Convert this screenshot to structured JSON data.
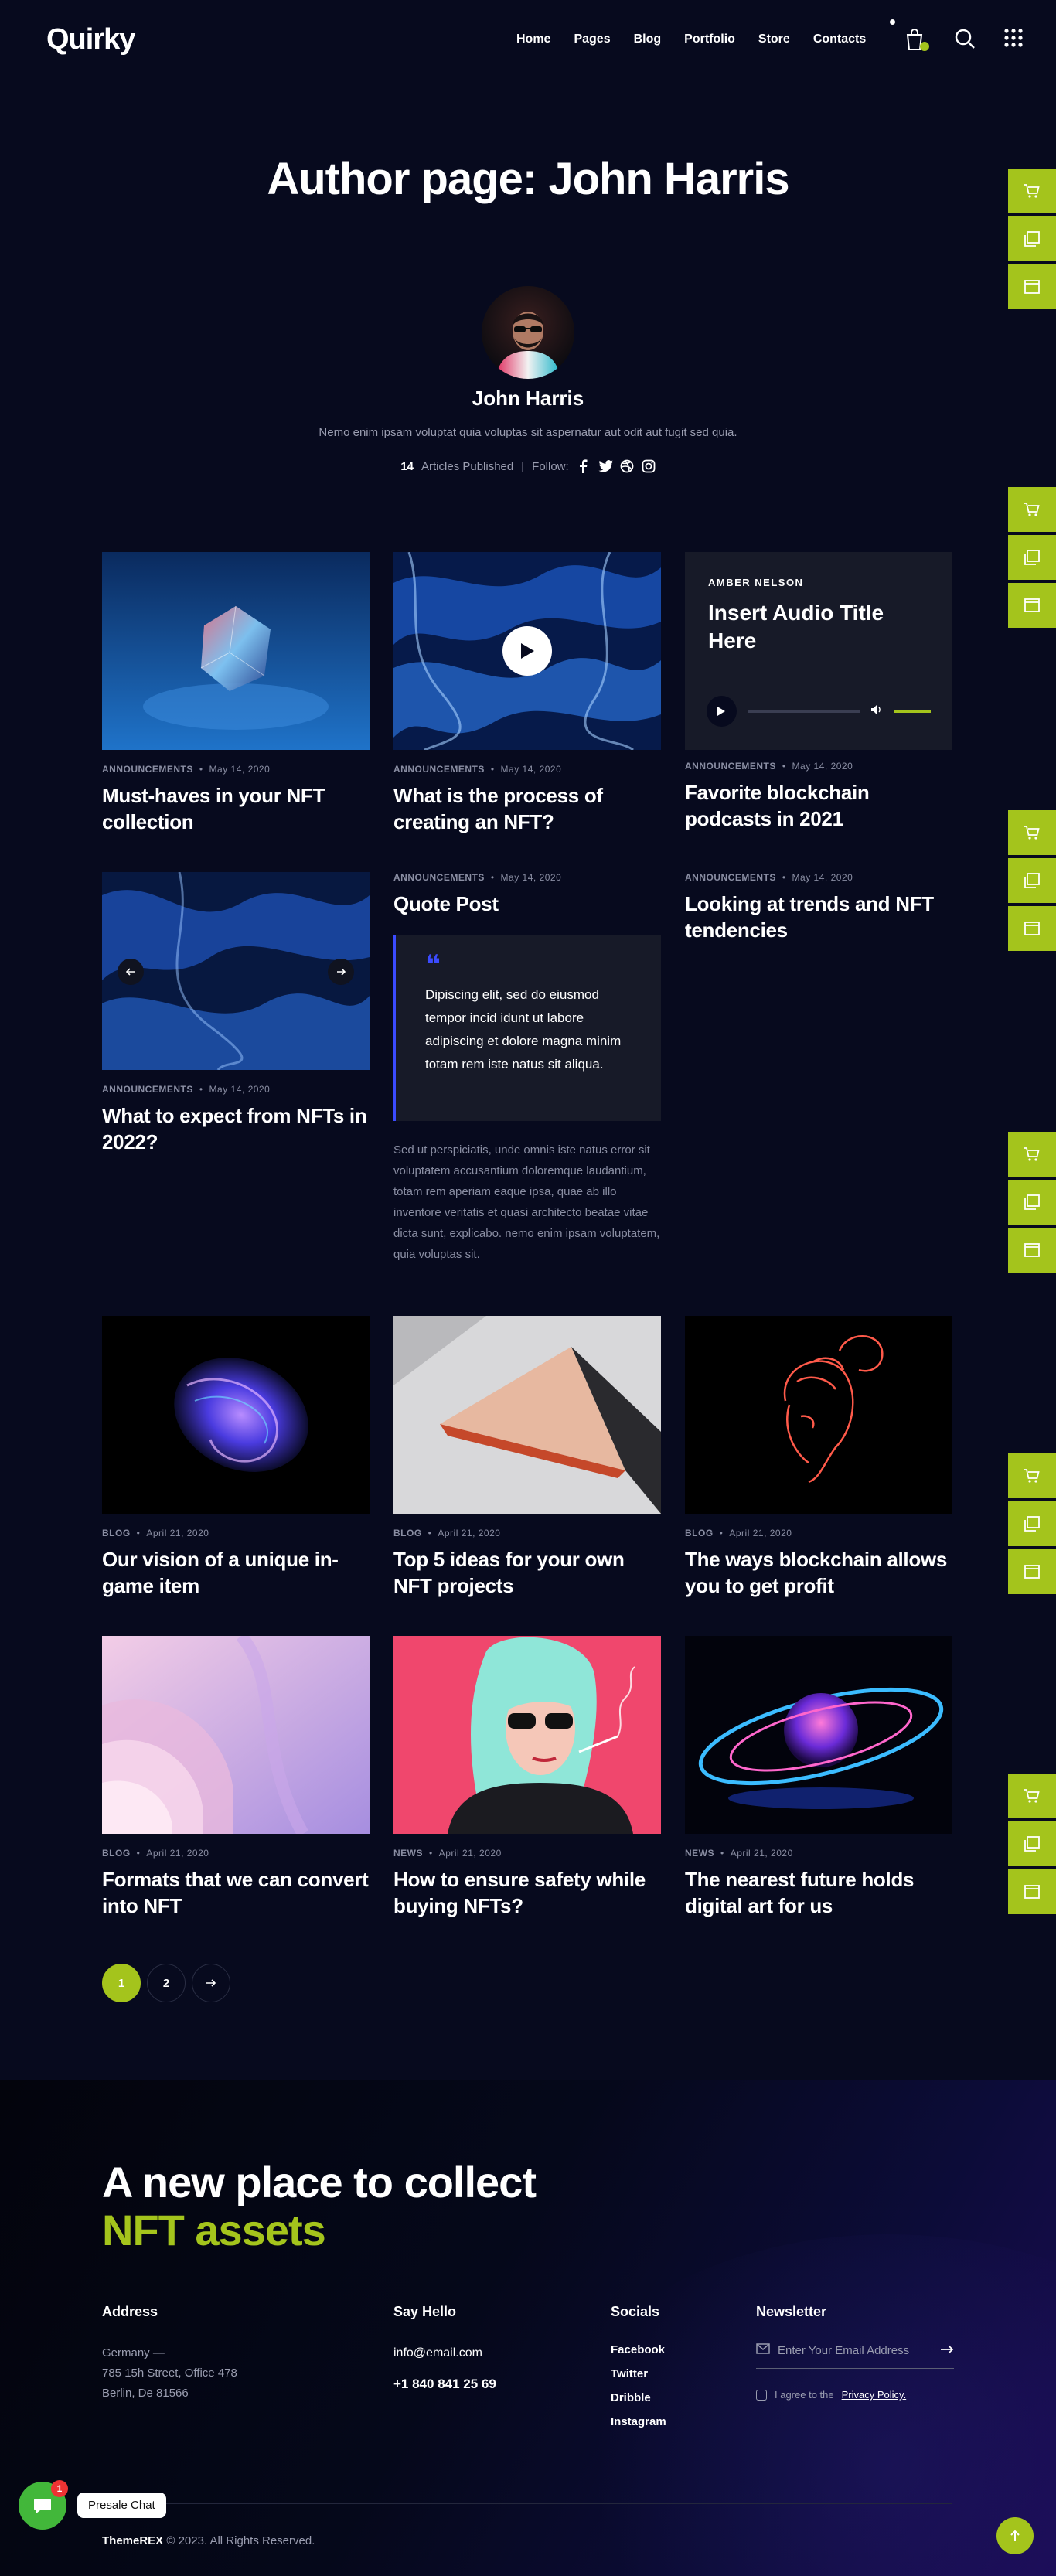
{
  "header": {
    "logo": "Quirky",
    "nav": [
      "Home",
      "Pages",
      "Blog",
      "Portfolio",
      "Store",
      "Contacts"
    ]
  },
  "page_title": "Author page: John Harris",
  "author": {
    "name": "John Harris",
    "bio": "Nemo enim ipsam voluptat quia voluptas sit aspernatur aut odit aut fugit sed quia.",
    "articles_count": "14",
    "articles_label": "Articles Published",
    "follow_label": "Follow:"
  },
  "posts": {
    "p1": {
      "category": "ANNOUNCEMENTS",
      "date": "May 14, 2020",
      "title": "Must-haves in your NFT collection"
    },
    "p2": {
      "category": "ANNOUNCEMENTS",
      "date": "May 14, 2020",
      "title": "What is the process of creating an NFT?"
    },
    "p3": {
      "category": "ANNOUNCEMENTS",
      "date": "May 14, 2020",
      "title": "Favorite blockchain podcasts in 2021",
      "audio_author": "AMBER NELSON",
      "audio_title": "Insert Audio Title Here"
    },
    "p4": {
      "category": "ANNOUNCEMENTS",
      "date": "May 14, 2020",
      "title": "What to expect from NFTs in 2022?"
    },
    "p5": {
      "category": "ANNOUNCEMENTS",
      "date": "May 14, 2020",
      "title": "Quote Post",
      "quote": "Dipiscing elit, sed do eiusmod tempor incid idunt ut labore adipiscing et dolore magna minim totam rem iste natus sit aliqua.",
      "body": "Sed ut perspiciatis, unde omnis iste natus error sit voluptatem accusantium doloremque laudantium, totam rem aperiam eaque ipsa, quae ab illo inventore veritatis et quasi architecto beatae vitae dicta sunt, explicabo. nemo enim ipsam voluptatem, quia voluptas sit."
    },
    "p6": {
      "category": "ANNOUNCEMENTS",
      "date": "May 14, 2020",
      "title": "Looking at trends and NFT tendencies"
    },
    "p7": {
      "category": "BLOG",
      "date": "April 21, 2020",
      "title": "Our vision of a unique in-game item"
    },
    "p8": {
      "category": "BLOG",
      "date": "April 21, 2020",
      "title": "Top 5 ideas for your own NFT projects"
    },
    "p9": {
      "category": "BLOG",
      "date": "April 21, 2020",
      "title": "The ways blockchain allows you to get profit"
    },
    "p10": {
      "category": "BLOG",
      "date": "April 21, 2020",
      "title": "Formats that we can convert into NFT"
    },
    "p11": {
      "category": "NEWS",
      "date": "April 21, 2020",
      "title": "How to ensure safety while buying NFTs?"
    },
    "p12": {
      "category": "NEWS",
      "date": "April 21, 2020",
      "title": "The nearest future holds digital art for us"
    }
  },
  "pagination": {
    "page1": "1",
    "page2": "2"
  },
  "footer": {
    "headline_1": "A new place to collect",
    "headline_2": "NFT assets",
    "address_title": "Address",
    "address_line1": "Germany —",
    "address_line2": "785 15h Street, Office 478",
    "address_line3": "Berlin, De 81566",
    "hello_title": "Say Hello",
    "email": "info@email.com",
    "phone": "+1 840 841 25 69",
    "socials_title": "Socials",
    "socials": [
      "Facebook",
      "Twitter",
      "Dribble",
      "Instagram"
    ],
    "newsletter_title": "Newsletter",
    "newsletter_placeholder": "Enter Your Email Address",
    "agree_text": "I agree to the",
    "privacy_link": "Privacy Policy.",
    "copyright_brand": "ThemeREX",
    "copyright_text": "© 2023. All Rights Reserved."
  },
  "chat": {
    "label": "Presale Chat",
    "badge": "1"
  },
  "colors": {
    "accent": "#a4c41c",
    "background": "#070a1e",
    "quote_accent": "#3b4bff"
  }
}
